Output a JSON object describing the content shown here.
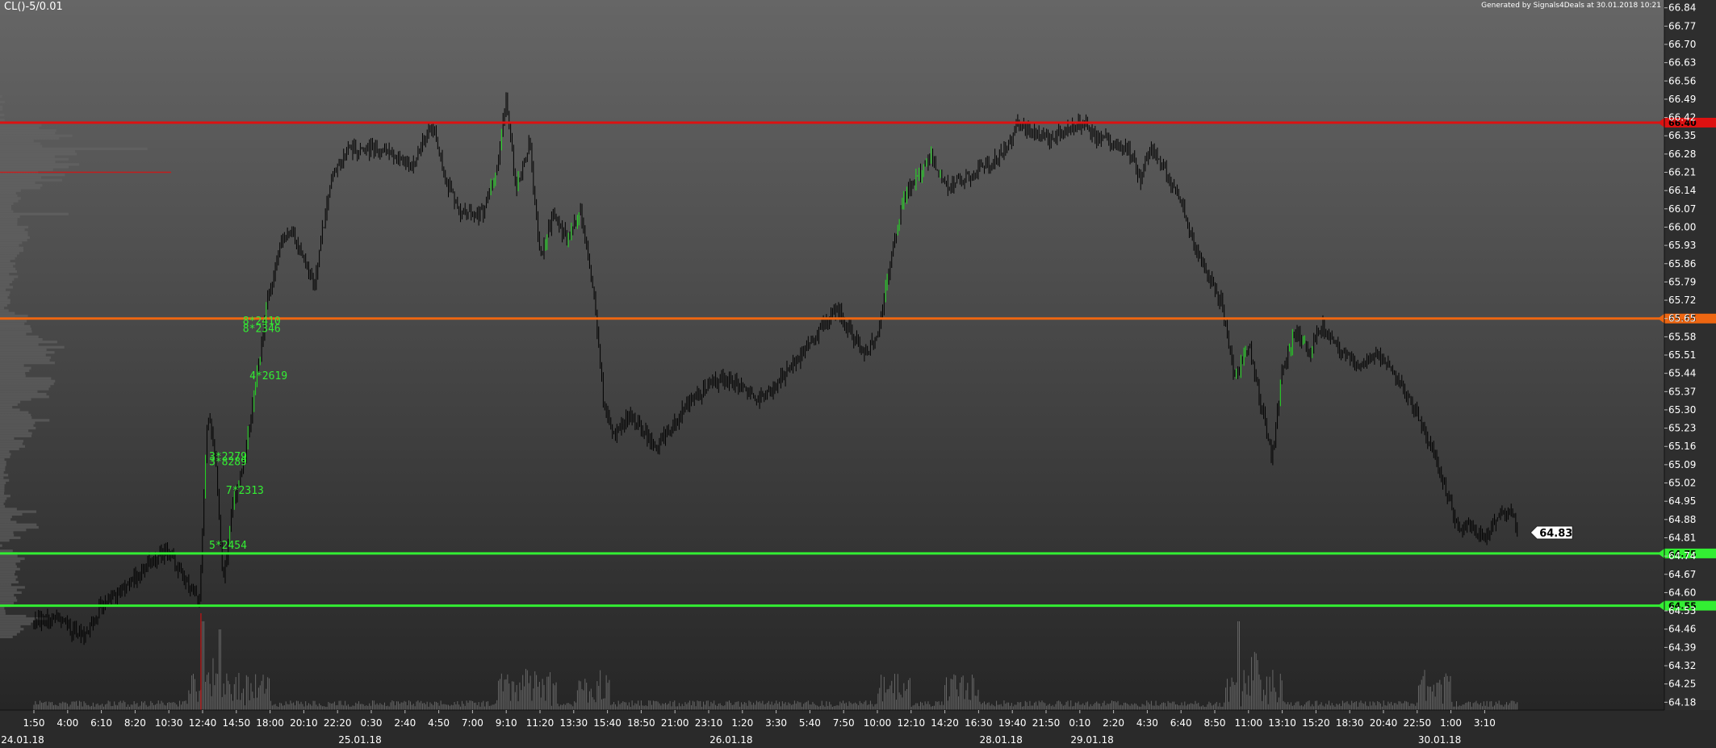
{
  "header": {
    "symbol": "CL()-5/0.01",
    "generated": "Generated by Signals4Deals at 30.01.2018 10:21"
  },
  "colors": {
    "resistance": "#dd1111",
    "pivot": "#ee6611",
    "support": "#33ee33",
    "bar": "#000000",
    "bar_up": "#22dd22",
    "volume": "#777777",
    "profile": "#666666"
  },
  "chart_data": {
    "type": "bar",
    "ylim": [
      64.15,
      66.87
    ],
    "y_ticks": [
      "64.18",
      "64.25",
      "64.32",
      "64.39",
      "64.46",
      "64.53",
      "64.60",
      "64.67",
      "64.74",
      "64.81",
      "64.88",
      "64.95",
      "65.02",
      "65.09",
      "65.16",
      "65.23",
      "65.30",
      "65.37",
      "65.44",
      "65.51",
      "65.58",
      "65.65",
      "65.72",
      "65.79",
      "65.86",
      "65.93",
      "66.00",
      "66.07",
      "66.14",
      "66.21",
      "66.28",
      "66.35",
      "66.42",
      "66.49",
      "66.56",
      "66.63",
      "66.70",
      "66.77",
      "66.84"
    ],
    "x_ticks": [
      "1:50",
      "4:00",
      "6:10",
      "8:20",
      "10:30",
      "12:40",
      "14:50",
      "18:00",
      "20:10",
      "22:20",
      "0:30",
      "2:40",
      "4:50",
      "7:00",
      "9:10",
      "11:20",
      "13:30",
      "15:40",
      "18:50",
      "21:00",
      "23:10",
      "1:20",
      "3:30",
      "5:40",
      "7:50",
      "10:00",
      "12:10",
      "14:20",
      "16:30",
      "19:40",
      "21:50",
      "0:10",
      "2:20",
      "4:30",
      "6:40",
      "8:50",
      "11:00",
      "13:10",
      "15:20",
      "18:30",
      "20:40",
      "22:50",
      "1:00",
      "3:10"
    ],
    "date_labels": [
      "24.01.18",
      "25.01.18",
      "26.01.18",
      "28.01.18",
      "29.01.18",
      "30.01.18"
    ],
    "levels": [
      {
        "value": 66.4,
        "label": "66.40",
        "role": "resistance"
      },
      {
        "value": 65.65,
        "label": "65.65",
        "role": "pivot"
      },
      {
        "value": 64.75,
        "label": "64.75",
        "role": "support"
      },
      {
        "value": 64.55,
        "label": "64.55",
        "role": "support"
      }
    ],
    "last_price": {
      "value": 64.83,
      "label": "64.83"
    },
    "annotations": [
      {
        "text": "8*2410",
        "x_index": 6.0,
        "value": 65.64
      },
      {
        "text": "8*2346",
        "x_index": 6.0,
        "value": 65.61
      },
      {
        "text": "4*2619",
        "x_index": 6.2,
        "value": 65.43
      },
      {
        "text": "3*2279",
        "x_index": 5.0,
        "value": 65.12
      },
      {
        "text": "3*8289",
        "x_index": 5.0,
        "value": 65.1
      },
      {
        "text": "7*2313",
        "x_index": 5.5,
        "value": 64.99
      },
      {
        "text": "5*2454",
        "x_index": 5.0,
        "value": 64.78
      }
    ],
    "price_path": [
      {
        "t": 0.0,
        "p": 64.48
      },
      {
        "t": 0.6,
        "p": 64.51
      },
      {
        "t": 1.0,
        "p": 64.47
      },
      {
        "t": 1.5,
        "p": 64.43
      },
      {
        "t": 2.0,
        "p": 64.55
      },
      {
        "t": 2.5,
        "p": 64.6
      },
      {
        "t": 3.0,
        "p": 64.66
      },
      {
        "t": 3.5,
        "p": 64.72
      },
      {
        "t": 4.0,
        "p": 64.76
      },
      {
        "t": 4.5,
        "p": 64.64
      },
      {
        "t": 4.9,
        "p": 64.56
      },
      {
        "t": 5.15,
        "p": 65.3
      },
      {
        "t": 5.4,
        "p": 65.1
      },
      {
        "t": 5.6,
        "p": 64.62
      },
      {
        "t": 5.85,
        "p": 64.9
      },
      {
        "t": 6.3,
        "p": 65.15
      },
      {
        "t": 6.6,
        "p": 65.42
      },
      {
        "t": 6.9,
        "p": 65.7
      },
      {
        "t": 7.3,
        "p": 65.92
      },
      {
        "t": 7.6,
        "p": 66.0
      },
      {
        "t": 8.0,
        "p": 65.88
      },
      {
        "t": 8.3,
        "p": 65.78
      },
      {
        "t": 8.8,
        "p": 66.18
      },
      {
        "t": 9.3,
        "p": 66.3
      },
      {
        "t": 10.0,
        "p": 66.3
      },
      {
        "t": 10.6,
        "p": 66.28
      },
      {
        "t": 11.2,
        "p": 66.22
      },
      {
        "t": 11.8,
        "p": 66.4
      },
      {
        "t": 12.2,
        "p": 66.18
      },
      {
        "t": 12.7,
        "p": 66.05
      },
      {
        "t": 13.3,
        "p": 66.05
      },
      {
        "t": 13.8,
        "p": 66.28
      },
      {
        "t": 14.0,
        "p": 66.5
      },
      {
        "t": 14.3,
        "p": 66.15
      },
      {
        "t": 14.7,
        "p": 66.32
      },
      {
        "t": 15.0,
        "p": 65.88
      },
      {
        "t": 15.4,
        "p": 66.05
      },
      {
        "t": 15.8,
        "p": 65.95
      },
      {
        "t": 16.2,
        "p": 66.05
      },
      {
        "t": 16.6,
        "p": 65.75
      },
      {
        "t": 16.9,
        "p": 65.3
      },
      {
        "t": 17.2,
        "p": 65.2
      },
      {
        "t": 17.6,
        "p": 65.28
      },
      {
        "t": 18.0,
        "p": 65.24
      },
      {
        "t": 18.4,
        "p": 65.15
      },
      {
        "t": 18.8,
        "p": 65.22
      },
      {
        "t": 19.4,
        "p": 65.32
      },
      {
        "t": 20.0,
        "p": 65.4
      },
      {
        "t": 20.6,
        "p": 65.42
      },
      {
        "t": 21.0,
        "p": 65.38
      },
      {
        "t": 21.5,
        "p": 65.34
      },
      {
        "t": 22.0,
        "p": 65.4
      },
      {
        "t": 22.6,
        "p": 65.48
      },
      {
        "t": 23.0,
        "p": 65.55
      },
      {
        "t": 23.4,
        "p": 65.62
      },
      {
        "t": 23.8,
        "p": 65.68
      },
      {
        "t": 24.2,
        "p": 65.6
      },
      {
        "t": 24.6,
        "p": 65.52
      },
      {
        "t": 25.0,
        "p": 65.58
      },
      {
        "t": 25.4,
        "p": 65.88
      },
      {
        "t": 25.8,
        "p": 66.12
      },
      {
        "t": 26.2,
        "p": 66.2
      },
      {
        "t": 26.6,
        "p": 66.28
      },
      {
        "t": 27.0,
        "p": 66.15
      },
      {
        "t": 27.5,
        "p": 66.18
      },
      {
        "t": 28.0,
        "p": 66.22
      },
      {
        "t": 28.5,
        "p": 66.26
      },
      {
        "t": 28.9,
        "p": 66.32
      },
      {
        "t": 29.2,
        "p": 66.4
      },
      {
        "t": 29.6,
        "p": 66.36
      },
      {
        "t": 30.0,
        "p": 66.34
      },
      {
        "t": 30.5,
        "p": 66.36
      },
      {
        "t": 31.0,
        "p": 66.4
      },
      {
        "t": 31.5,
        "p": 66.35
      },
      {
        "t": 32.0,
        "p": 66.32
      },
      {
        "t": 32.5,
        "p": 66.28
      },
      {
        "t": 32.8,
        "p": 66.18
      },
      {
        "t": 33.1,
        "p": 66.32
      },
      {
        "t": 33.5,
        "p": 66.22
      },
      {
        "t": 34.0,
        "p": 66.1
      },
      {
        "t": 34.4,
        "p": 65.92
      },
      {
        "t": 34.8,
        "p": 65.82
      },
      {
        "t": 35.2,
        "p": 65.7
      },
      {
        "t": 35.6,
        "p": 65.42
      },
      {
        "t": 36.0,
        "p": 65.55
      },
      {
        "t": 36.4,
        "p": 65.3
      },
      {
        "t": 36.7,
        "p": 65.12
      },
      {
        "t": 37.0,
        "p": 65.45
      },
      {
        "t": 37.4,
        "p": 65.6
      },
      {
        "t": 37.8,
        "p": 65.52
      },
      {
        "t": 38.2,
        "p": 65.62
      },
      {
        "t": 38.6,
        "p": 65.55
      },
      {
        "t": 39.0,
        "p": 65.5
      },
      {
        "t": 39.4,
        "p": 65.48
      },
      {
        "t": 39.8,
        "p": 65.52
      },
      {
        "t": 40.2,
        "p": 65.46
      },
      {
        "t": 40.6,
        "p": 65.38
      },
      {
        "t": 41.0,
        "p": 65.28
      },
      {
        "t": 41.4,
        "p": 65.16
      },
      {
        "t": 41.8,
        "p": 65.02
      },
      {
        "t": 42.2,
        "p": 64.84
      },
      {
        "t": 42.6,
        "p": 64.86
      },
      {
        "t": 43.0,
        "p": 64.8
      },
      {
        "t": 43.4,
        "p": 64.9
      },
      {
        "t": 43.8,
        "p": 64.92
      },
      {
        "t": 44.0,
        "p": 64.83
      }
    ]
  }
}
